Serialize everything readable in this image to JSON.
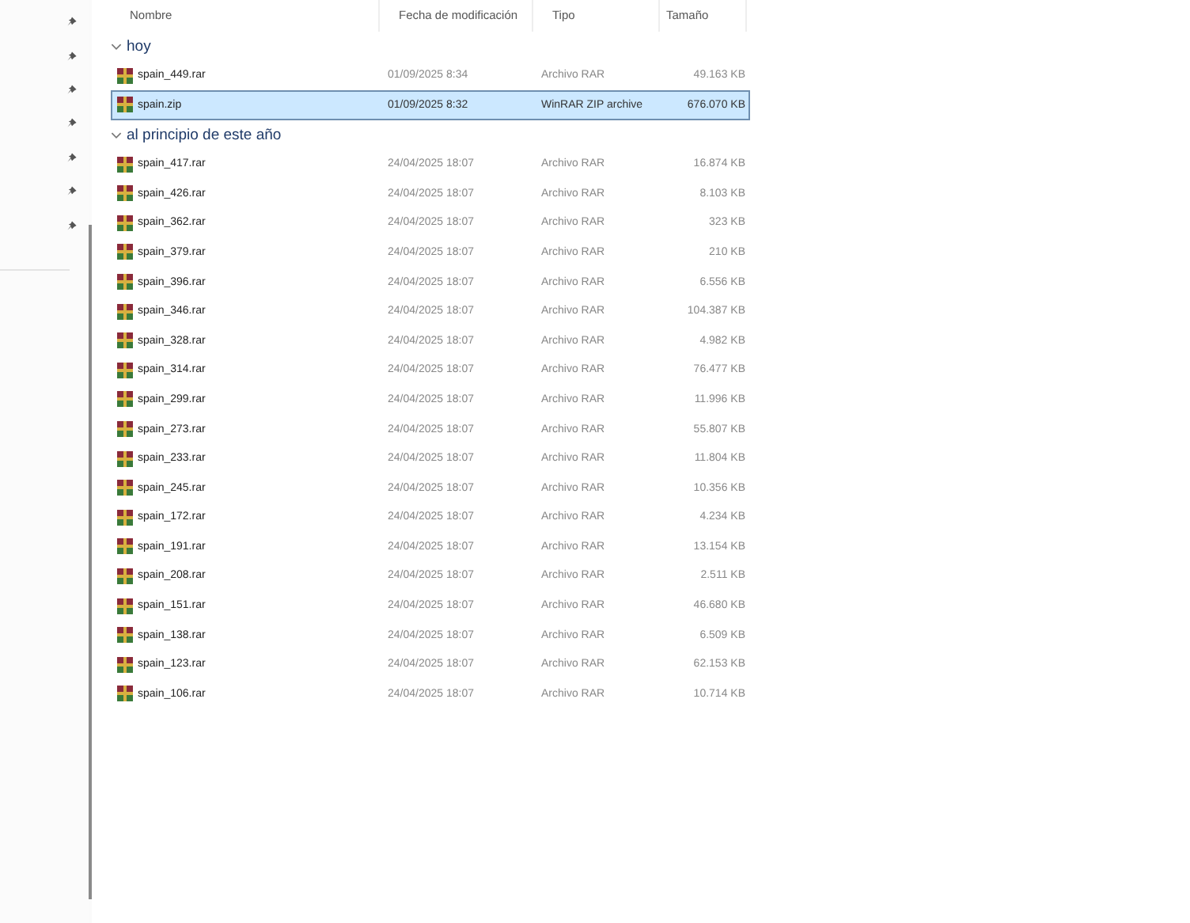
{
  "navigation_pane": {
    "items": [
      {
        "pinned": true
      },
      {
        "pinned": true
      },
      {
        "pinned": true
      },
      {
        "pinned": true
      },
      {
        "pinned": true
      },
      {
        "pinned": true
      },
      {
        "pinned": true
      }
    ]
  },
  "file_list": {
    "columns": [
      "Nombre",
      "Fecha de modificación",
      "Tipo",
      "Tamaño"
    ],
    "groups": [
      {
        "label": "hoy",
        "expanded": true,
        "files": [
          {
            "name": "spain_449.rar",
            "modified": "01/09/2025 8:34",
            "type": "Archivo RAR",
            "size": "49.163 KB",
            "selected": false
          },
          {
            "name": "spain.zip",
            "modified": "01/09/2025 8:32",
            "type": "WinRAR ZIP archive",
            "size": "676.070 KB",
            "selected": true
          }
        ]
      },
      {
        "label": "al principio de este año",
        "expanded": true,
        "files": [
          {
            "name": "spain_417.rar",
            "modified": "24/04/2025 18:07",
            "type": "Archivo RAR",
            "size": "16.874 KB",
            "selected": false
          },
          {
            "name": "spain_426.rar",
            "modified": "24/04/2025 18:07",
            "type": "Archivo RAR",
            "size": "8.103 KB",
            "selected": false
          },
          {
            "name": "spain_362.rar",
            "modified": "24/04/2025 18:07",
            "type": "Archivo RAR",
            "size": "323 KB",
            "selected": false
          },
          {
            "name": "spain_379.rar",
            "modified": "24/04/2025 18:07",
            "type": "Archivo RAR",
            "size": "210 KB",
            "selected": false
          },
          {
            "name": "spain_396.rar",
            "modified": "24/04/2025 18:07",
            "type": "Archivo RAR",
            "size": "6.556 KB",
            "selected": false
          },
          {
            "name": "spain_346.rar",
            "modified": "24/04/2025 18:07",
            "type": "Archivo RAR",
            "size": "104.387 KB",
            "selected": false
          },
          {
            "name": "spain_328.rar",
            "modified": "24/04/2025 18:07",
            "type": "Archivo RAR",
            "size": "4.982 KB",
            "selected": false
          },
          {
            "name": "spain_314.rar",
            "modified": "24/04/2025 18:07",
            "type": "Archivo RAR",
            "size": "76.477 KB",
            "selected": false
          },
          {
            "name": "spain_299.rar",
            "modified": "24/04/2025 18:07",
            "type": "Archivo RAR",
            "size": "11.996 KB",
            "selected": false
          },
          {
            "name": "spain_273.rar",
            "modified": "24/04/2025 18:07",
            "type": "Archivo RAR",
            "size": "55.807 KB",
            "selected": false
          },
          {
            "name": "spain_233.rar",
            "modified": "24/04/2025 18:07",
            "type": "Archivo RAR",
            "size": "11.804 KB",
            "selected": false
          },
          {
            "name": "spain_245.rar",
            "modified": "24/04/2025 18:07",
            "type": "Archivo RAR",
            "size": "10.356 KB",
            "selected": false
          },
          {
            "name": "spain_172.rar",
            "modified": "24/04/2025 18:07",
            "type": "Archivo RAR",
            "size": "4.234 KB",
            "selected": false
          },
          {
            "name": "spain_191.rar",
            "modified": "24/04/2025 18:07",
            "type": "Archivo RAR",
            "size": "13.154 KB",
            "selected": false
          },
          {
            "name": "spain_208.rar",
            "modified": "24/04/2025 18:07",
            "type": "Archivo RAR",
            "size": "2.511 KB",
            "selected": false
          },
          {
            "name": "spain_151.rar",
            "modified": "24/04/2025 18:07",
            "type": "Archivo RAR",
            "size": "46.680 KB",
            "selected": false
          },
          {
            "name": "spain_138.rar",
            "modified": "24/04/2025 18:07",
            "type": "Archivo RAR",
            "size": "6.509 KB",
            "selected": false
          },
          {
            "name": "spain_123.rar",
            "modified": "24/04/2025 18:07",
            "type": "Archivo RAR",
            "size": "62.153 KB",
            "selected": false
          },
          {
            "name": "spain_106.rar",
            "modified": "24/04/2025 18:07",
            "type": "Archivo RAR",
            "size": "10.714 KB",
            "selected": false
          }
        ]
      }
    ]
  }
}
